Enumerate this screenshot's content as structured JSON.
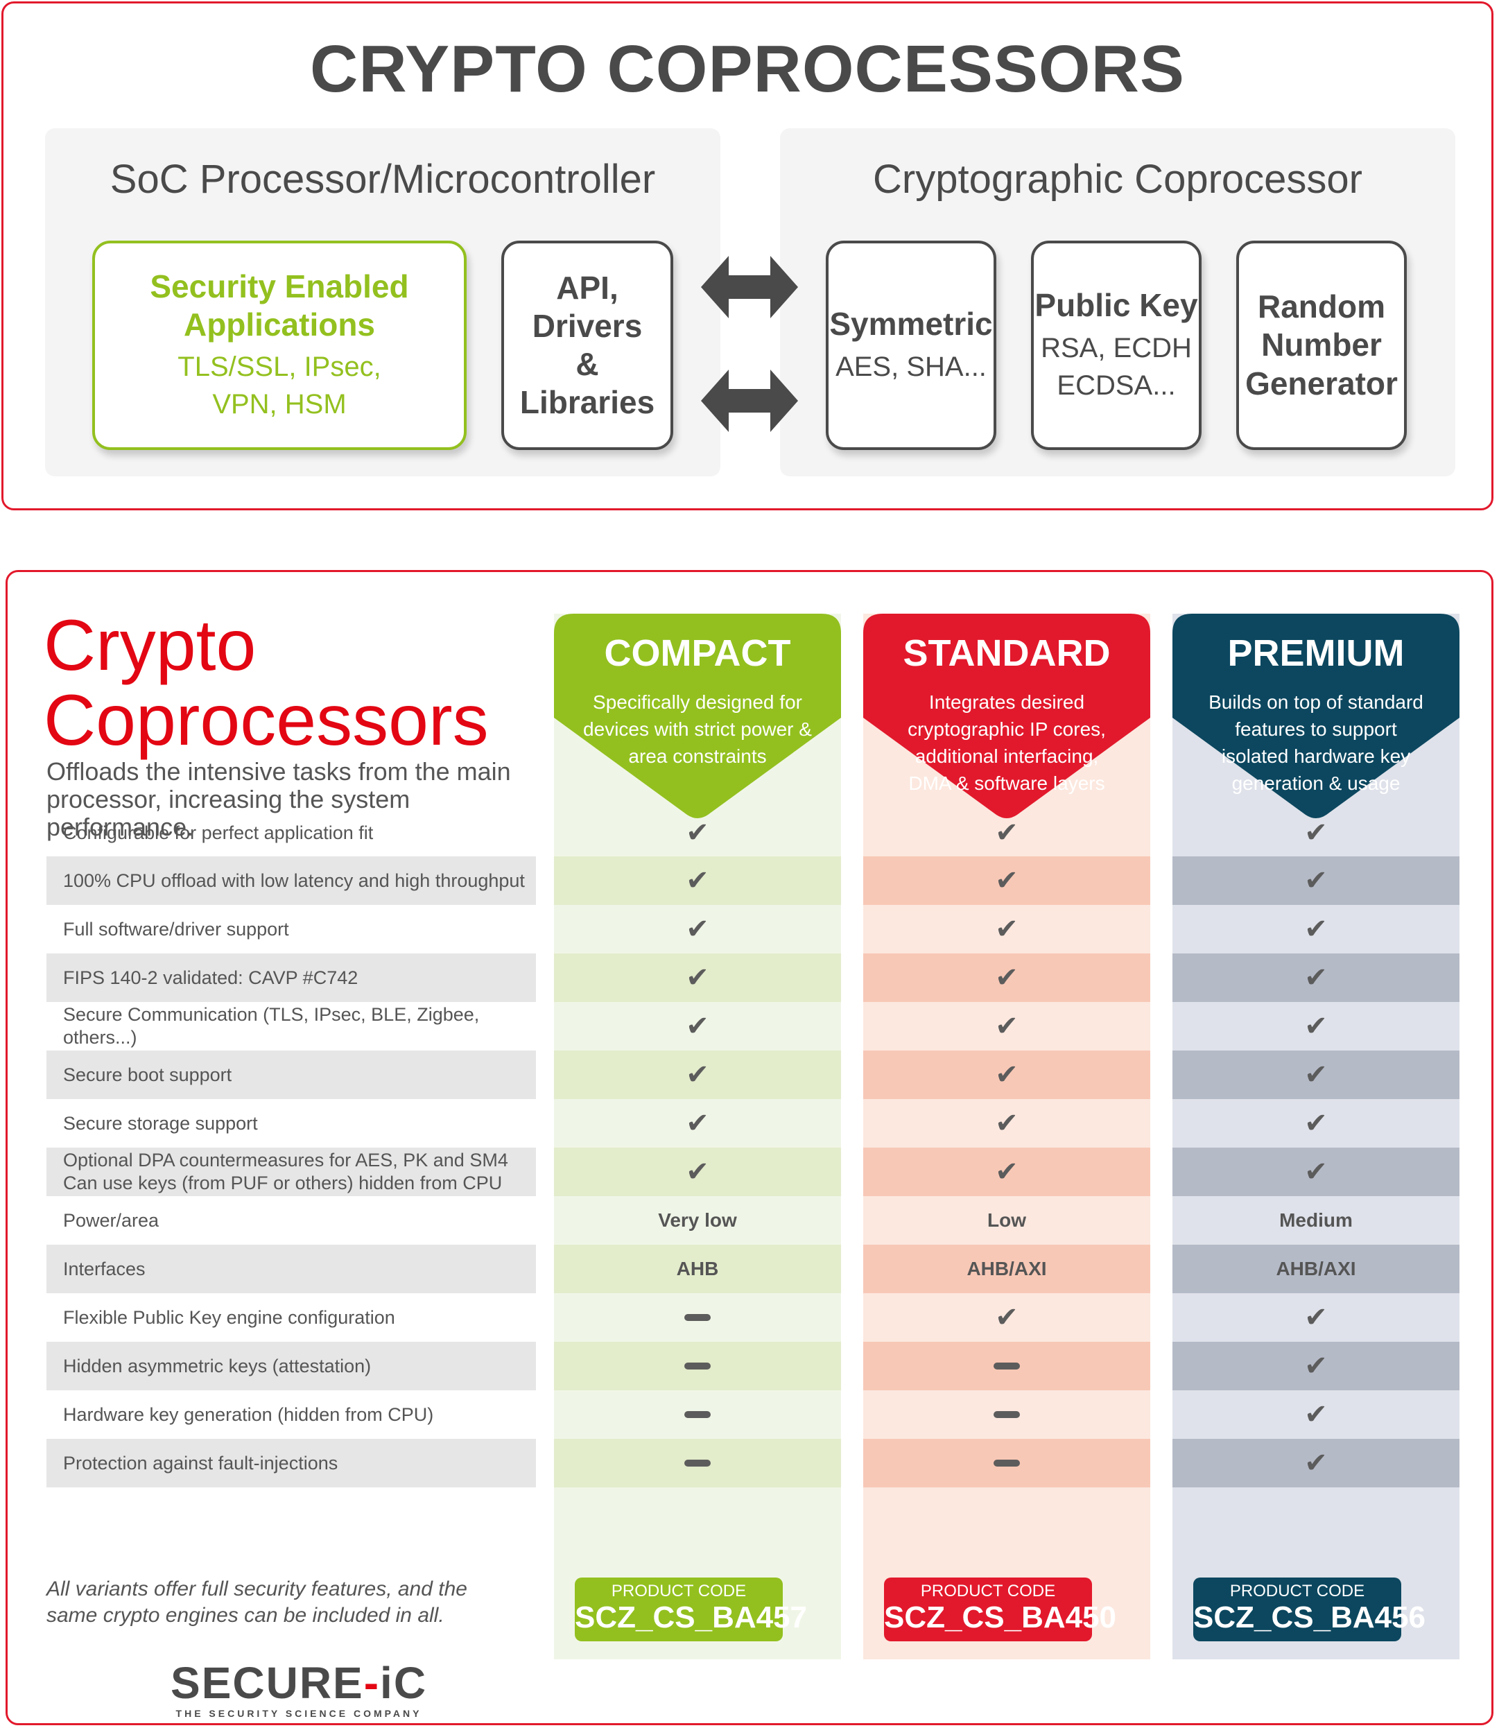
{
  "top": {
    "title": "CRYPTO COPROCESSORS",
    "soc": {
      "title": "SoC Processor/Microcontroller",
      "security_card": {
        "heading_1": "Security Enabled",
        "heading_2": "Applications",
        "sub_1": "TLS/SSL, IPsec,",
        "sub_2": "VPN, HSM"
      },
      "api_card": {
        "line_1": "API,",
        "line_2": "Drivers",
        "line_3": "& Libraries"
      }
    },
    "coprocessor": {
      "title": "Cryptographic Coprocessor",
      "symmetric_card": {
        "heading": "Symmetric",
        "sub_1": "AES, SHA..."
      },
      "public_key_card": {
        "heading": "Public Key",
        "sub_1": "RSA, ECDH",
        "sub_2": "ECDSA..."
      },
      "rng_card": {
        "line_1": "Random",
        "line_2": "Number",
        "line_3": "Generator"
      }
    }
  },
  "bottom": {
    "title_1": "Crypto",
    "title_2": "Coprocessors",
    "subtitle": "Offloads the intensive tasks from the main processor, increasing the system performance.",
    "note": "All variants offer full security features, and the same crypto engines can be included in all.",
    "logo": {
      "main_1": "SECURE",
      "main_sep": "-",
      "main_2": "iC",
      "tagline": "THE SECURITY SCIENCE COMPANY"
    },
    "columns": [
      {
        "name": "COMPACT",
        "desc": "Specifically designed for devices with strict power & area constraints",
        "color": "#93c01f",
        "alt_row_color": "#e3eccb",
        "product_code_label": "PRODUCT CODE",
        "product_code": "SCZ_CS_BA457"
      },
      {
        "name": "STANDARD",
        "desc": "Integrates desired cryptographic IP cores, additional interfacing, DMA & software layers",
        "color": "#e2192c",
        "alt_row_color": "#f8c8b6",
        "product_code_label": "PRODUCT CODE",
        "product_code": "SCZ_CS_BA450"
      },
      {
        "name": "PREMIUM",
        "desc": "Builds on top of standard features to support isolated hardware key generation & usage",
        "color": "#0c475f",
        "alt_row_color": "#b5bac7",
        "product_code_label": "PRODUCT CODE",
        "product_code": "SCZ_CS_BA456"
      }
    ],
    "rows": [
      {
        "label": "Configurable for perfect application fit",
        "values": [
          "check",
          "check",
          "check"
        ]
      },
      {
        "label": "100% CPU offload with low latency and high throughput",
        "values": [
          "check",
          "check",
          "check"
        ]
      },
      {
        "label": "Full software/driver support",
        "values": [
          "check",
          "check",
          "check"
        ]
      },
      {
        "label": "FIPS 140-2 validated: CAVP #C742",
        "values": [
          "check",
          "check",
          "check"
        ]
      },
      {
        "label": "Secure Communication (TLS, IPsec, BLE, Zigbee, others...)",
        "values": [
          "check",
          "check",
          "check"
        ]
      },
      {
        "label": "Secure boot support",
        "values": [
          "check",
          "check",
          "check"
        ]
      },
      {
        "label": "Secure storage support",
        "values": [
          "check",
          "check",
          "check"
        ]
      },
      {
        "label": "Optional DPA countermeasures for AES, PK and SM4\nCan use keys (from PUF or others) hidden from CPU",
        "values": [
          "check",
          "check",
          "check"
        ]
      },
      {
        "label": "Power/area",
        "values": [
          "Very low",
          "Low",
          "Medium"
        ]
      },
      {
        "label": "Interfaces",
        "values": [
          "AHB",
          "AHB/AXI",
          "AHB/AXI"
        ]
      },
      {
        "label": "Flexible Public Key engine configuration",
        "values": [
          "dash",
          "check",
          "check"
        ]
      },
      {
        "label": "Hidden asymmetric keys (attestation)",
        "values": [
          "dash",
          "dash",
          "check"
        ]
      },
      {
        "label": "Hardware key generation (hidden from CPU)",
        "values": [
          "dash",
          "dash",
          "check"
        ]
      },
      {
        "label": "Protection against fault-injections",
        "values": [
          "dash",
          "dash",
          "check"
        ]
      }
    ],
    "icons": {
      "check": "✔",
      "dash": "dash-icon"
    }
  }
}
